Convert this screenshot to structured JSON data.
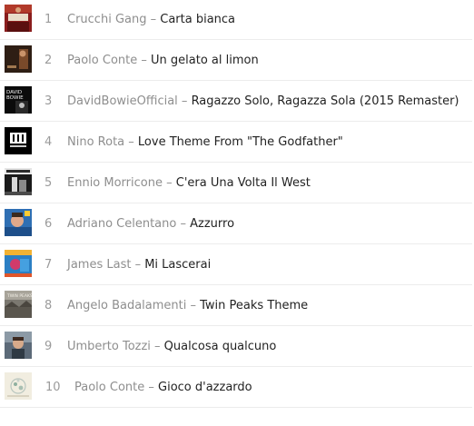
{
  "tracks": [
    {
      "rank": "1",
      "artist": "Crucchi Gang",
      "title": "Carta bianca",
      "cover": "carta-bianca-cover-art"
    },
    {
      "rank": "2",
      "artist": "Paolo Conte",
      "title": "Un gelato al limon",
      "cover": "gelato-al-limon-cover-art"
    },
    {
      "rank": "3",
      "artist": "DavidBowieOfficial",
      "title": "Ragazzo Solo, Ragazza Sola  (2015 Remaster)",
      "cover": "david-bowie-cover-art",
      "cover_text": "DAVID BOWIE"
    },
    {
      "rank": "4",
      "artist": "Nino Rota",
      "title": "Love Theme From \"The Godfather\"",
      "cover": "godfather-cover-art"
    },
    {
      "rank": "5",
      "artist": "Ennio Morricone",
      "title": "C'era Una Volta Il West",
      "cover": "morricone-cover-art"
    },
    {
      "rank": "6",
      "artist": "Adriano Celentano",
      "title": "Azzurro",
      "cover": "azzurro-cover-art"
    },
    {
      "rank": "7",
      "artist": "James Last",
      "title": "Mi Lascerai",
      "cover": "mi-lascerai-cover-art"
    },
    {
      "rank": "8",
      "artist": "Angelo Badalamenti",
      "title": "Twin Peaks Theme",
      "cover": "twin-peaks-cover-art",
      "cover_text": "TWIN PEAKS"
    },
    {
      "rank": "9",
      "artist": "Umberto Tozzi",
      "title": "Qualcosa qualcuno",
      "cover": "qualcosa-qualcuno-cover-art"
    },
    {
      "rank": "10",
      "artist": "Paolo Conte",
      "title": "Gioco d'azzardo",
      "cover": "gioco-dazzardo-cover-art"
    }
  ],
  "separator": " – "
}
